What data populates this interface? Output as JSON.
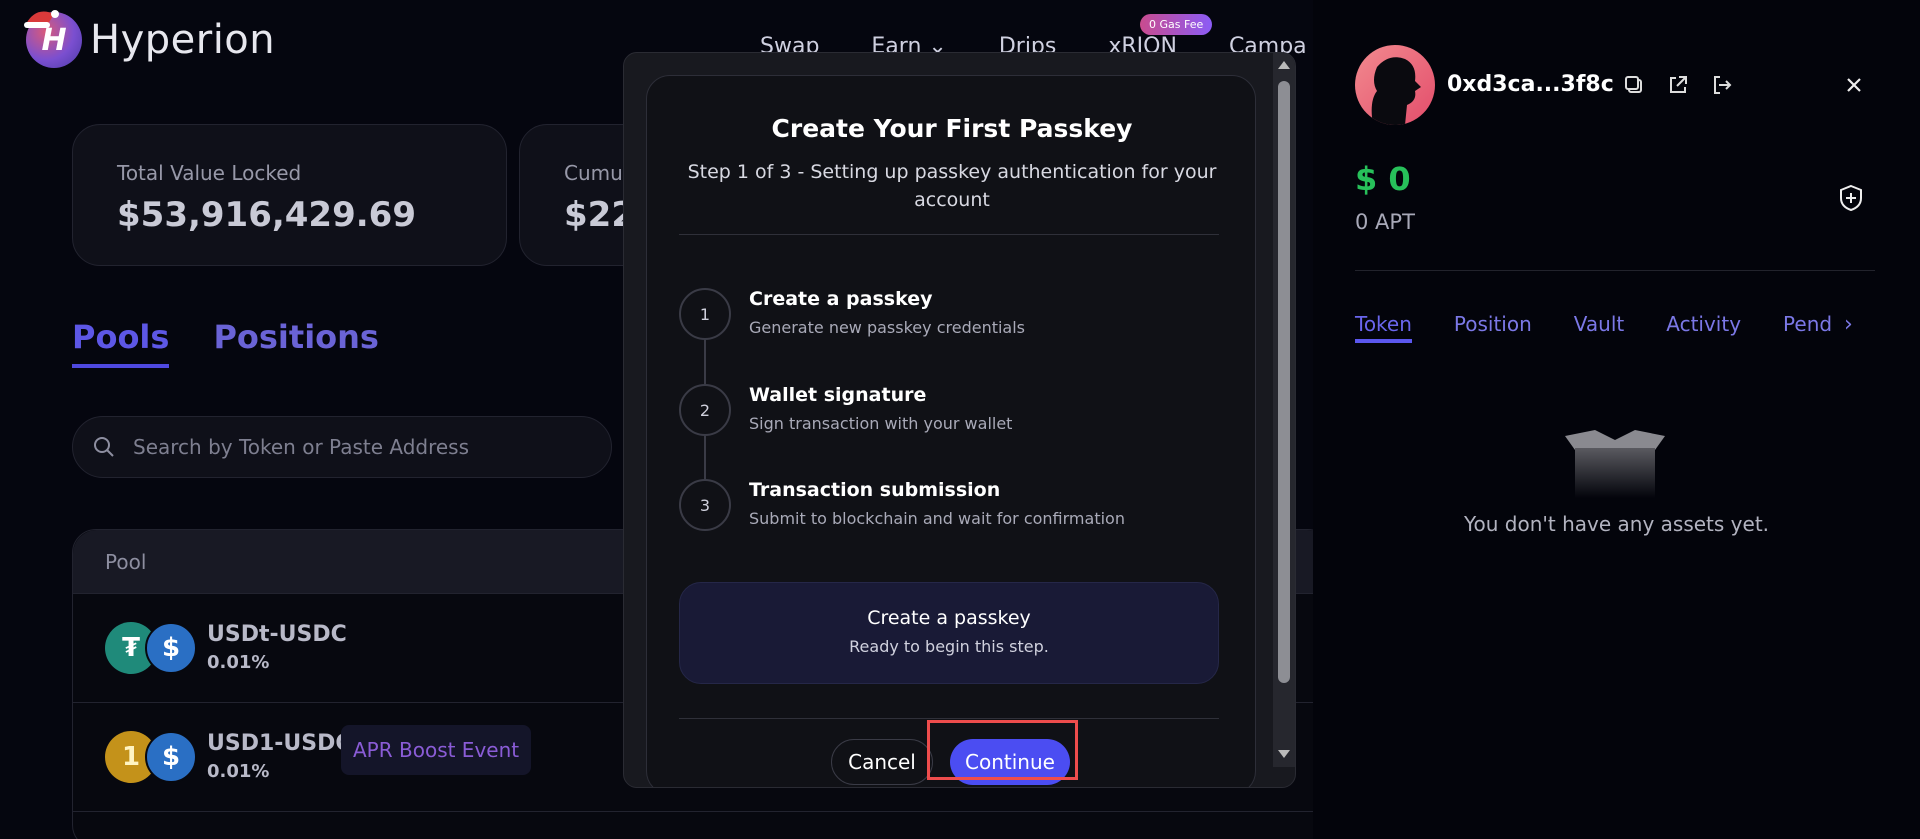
{
  "app": {
    "logo_text": "Hyperion",
    "nav": [
      "Swap",
      "Earn",
      "Drips",
      "xRION",
      "Campa"
    ],
    "gas_badge": "0 Gas Fee",
    "stats": [
      {
        "label": "Total Value Locked",
        "value": "$53,916,429.69"
      },
      {
        "label": "Cumul",
        "value": "$22,"
      }
    ],
    "tabs": [
      "Pools",
      "Positions"
    ],
    "search_placeholder": "Search by Token or Paste Address",
    "table_header": "Pool",
    "pools": [
      {
        "name": "USDt-USDC",
        "fee": "0.01%",
        "badge": ""
      },
      {
        "name": "USD1-USDC",
        "fee": "0.01%",
        "badge": "APR Boost Event"
      }
    ]
  },
  "modal": {
    "title": "Create Your First Passkey",
    "subtitle": "Step 1 of 3 - Setting up passkey authentication for your account",
    "steps": [
      {
        "num": "1",
        "title": "Create a passkey",
        "desc": "Generate new passkey credentials"
      },
      {
        "num": "2",
        "title": "Wallet signature",
        "desc": "Sign transaction with your wallet"
      },
      {
        "num": "3",
        "title": "Transaction submission",
        "desc": "Submit to blockchain and wait for confirmation"
      }
    ],
    "current": {
      "title": "Create a passkey",
      "desc": "Ready to begin this step."
    },
    "cancel_label": "Cancel",
    "continue_label": "Continue"
  },
  "wallet": {
    "address": "0xd3ca...3f8c",
    "balance": "$ 0",
    "apt": "0 APT",
    "tabs": [
      "Token",
      "Position",
      "Vault",
      "Activity",
      "Pend"
    ],
    "empty_text": "You don't have any assets yet.",
    "colors": {
      "balance": "#27c05a",
      "accent": "#5b57ee"
    }
  }
}
